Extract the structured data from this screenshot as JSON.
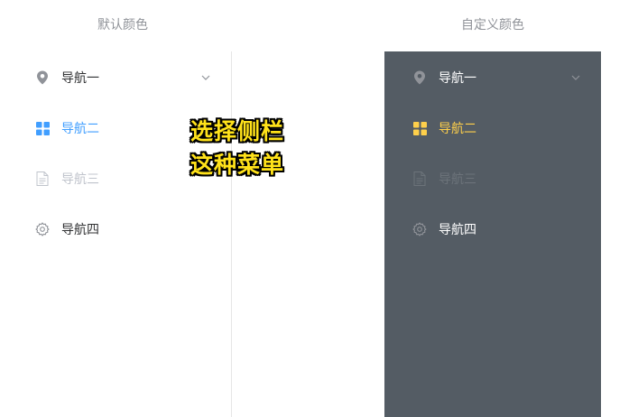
{
  "titles": {
    "default": "默认颜色",
    "custom": "自定义颜色"
  },
  "overlay": {
    "line1": "选择侧栏",
    "line2": "这种菜单"
  },
  "default_menu": {
    "colors": {
      "background": "#ffffff",
      "text": "#303133",
      "active_text": "#409eff",
      "disabled_text": "#c0c4cc",
      "icon": "#909399"
    },
    "items": [
      {
        "label": "导航一",
        "icon": "location-icon",
        "state": "normal",
        "has_submenu": true
      },
      {
        "label": "导航二",
        "icon": "menu-grid-icon",
        "state": "active",
        "has_submenu": false
      },
      {
        "label": "导航三",
        "icon": "document-icon",
        "state": "disabled",
        "has_submenu": false
      },
      {
        "label": "导航四",
        "icon": "setting-icon",
        "state": "normal",
        "has_submenu": false
      }
    ]
  },
  "custom_menu": {
    "colors": {
      "background": "#545c64",
      "text": "#ffffff",
      "active_text": "#ffd04b",
      "disabled_text": "#6c737a",
      "icon": "#909399"
    },
    "items": [
      {
        "label": "导航一",
        "icon": "location-icon",
        "state": "normal",
        "has_submenu": true
      },
      {
        "label": "导航二",
        "icon": "menu-grid-icon",
        "state": "active",
        "has_submenu": false
      },
      {
        "label": "导航三",
        "icon": "document-icon",
        "state": "disabled",
        "has_submenu": false
      },
      {
        "label": "导航四",
        "icon": "setting-icon",
        "state": "normal",
        "has_submenu": false
      }
    ]
  }
}
